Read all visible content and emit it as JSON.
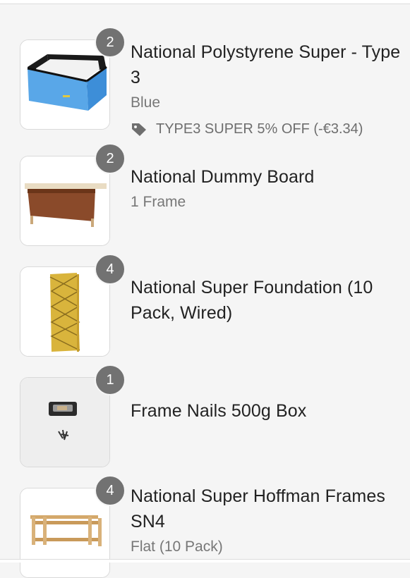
{
  "colors": {
    "background": "#f5f5f5",
    "badge": "#727272",
    "title": "#222222",
    "muted": "#777777"
  },
  "items": [
    {
      "quantity": "2",
      "title": "National Polystyrene Super - Type 3",
      "variant": "Blue",
      "discount": "TYPE3 SUPER 5% OFF (-€3.34)",
      "image_icon": "polystyrene-super-icon"
    },
    {
      "quantity": "2",
      "title": "National Dummy Board",
      "variant": "1 Frame",
      "image_icon": "dummy-board-icon"
    },
    {
      "quantity": "4",
      "title": "National Super Foundation (10 Pack, Wired)",
      "image_icon": "foundation-sheet-icon"
    },
    {
      "quantity": "1",
      "title": "Frame Nails 500g Box",
      "image_icon": "nails-box-icon"
    },
    {
      "quantity": "4",
      "title": "National Super Hoffman Frames SN4",
      "variant": "Flat (10 Pack)",
      "image_icon": "hoffman-frames-icon"
    }
  ]
}
